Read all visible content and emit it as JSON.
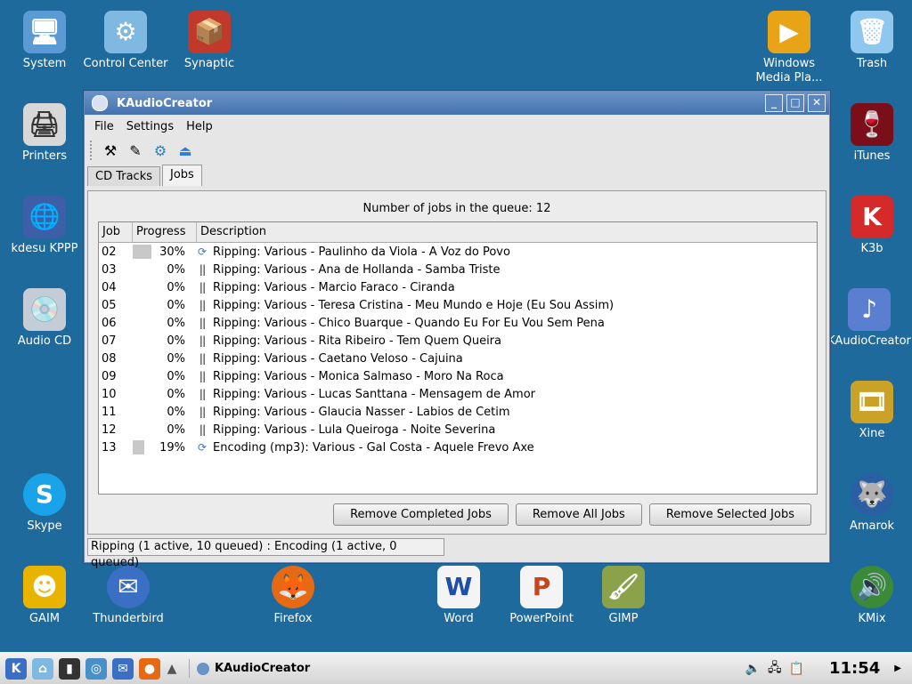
{
  "desktop_icons": [
    {
      "label": "System"
    },
    {
      "label": "Control Center"
    },
    {
      "label": "Synaptic"
    },
    {
      "label": "Windows Media Pla..."
    },
    {
      "label": "Trash"
    },
    {
      "label": "Printers"
    },
    {
      "label": "iTunes"
    },
    {
      "label": "kdesu KPPP"
    },
    {
      "label": "K3b"
    },
    {
      "label": "Audio CD"
    },
    {
      "label": "KAudioCreator"
    },
    {
      "label": "Xine"
    },
    {
      "label": "Skype"
    },
    {
      "label": "Amarok"
    },
    {
      "label": "GAIM"
    },
    {
      "label": "Thunderbird"
    },
    {
      "label": "Firefox"
    },
    {
      "label": "Word"
    },
    {
      "label": "PowerPoint"
    },
    {
      "label": "GIMP"
    },
    {
      "label": "KMix"
    }
  ],
  "window": {
    "title": "KAudioCreator",
    "menu": [
      "File",
      "Settings",
      "Help"
    ],
    "tabs": [
      "CD Tracks",
      "Jobs"
    ],
    "queue_info": "Number of jobs in the queue: 12",
    "columns": [
      "Job",
      "Progress",
      "Description"
    ],
    "jobs": [
      {
        "job": "02",
        "progress": "30%",
        "pct": 30,
        "state": "running",
        "description": "Ripping: Various - Paulinho da Viola - A Voz do Povo"
      },
      {
        "job": "03",
        "progress": "0%",
        "pct": 0,
        "state": "queued",
        "description": "Ripping: Various - Ana de Hollanda - Samba Triste"
      },
      {
        "job": "04",
        "progress": "0%",
        "pct": 0,
        "state": "queued",
        "description": "Ripping: Various - Marcio Faraco - Ciranda"
      },
      {
        "job": "05",
        "progress": "0%",
        "pct": 0,
        "state": "queued",
        "description": "Ripping: Various - Teresa Cristina - Meu Mundo e Hoje (Eu Sou Assim)"
      },
      {
        "job": "06",
        "progress": "0%",
        "pct": 0,
        "state": "queued",
        "description": "Ripping: Various - Chico Buarque - Quando Eu For Eu Vou Sem Pena"
      },
      {
        "job": "07",
        "progress": "0%",
        "pct": 0,
        "state": "queued",
        "description": "Ripping: Various - Rita Ribeiro - Tem Quem Queira"
      },
      {
        "job": "08",
        "progress": "0%",
        "pct": 0,
        "state": "queued",
        "description": "Ripping: Various - Caetano Veloso - Cajuina"
      },
      {
        "job": "09",
        "progress": "0%",
        "pct": 0,
        "state": "queued",
        "description": "Ripping: Various - Monica Salmaso - Moro Na Roca"
      },
      {
        "job": "10",
        "progress": "0%",
        "pct": 0,
        "state": "queued",
        "description": "Ripping: Various - Lucas Santtana - Mensagem de Amor"
      },
      {
        "job": "11",
        "progress": "0%",
        "pct": 0,
        "state": "queued",
        "description": "Ripping: Various - Glaucia Nasser - Labios de Cetim"
      },
      {
        "job": "12",
        "progress": "0%",
        "pct": 0,
        "state": "queued",
        "description": "Ripping: Various - Lula Queiroga - Noite Severina"
      },
      {
        "job": "13",
        "progress": "19%",
        "pct": 19,
        "state": "running",
        "description": "Encoding (mp3): Various - Gal Costa - Aquele Frevo Axe"
      }
    ],
    "buttons": {
      "remove_completed": "Remove Completed Jobs",
      "remove_all": "Remove All Jobs",
      "remove_selected": "Remove Selected Jobs"
    },
    "status": "Ripping (1 active, 10 queued) : Encoding (1 active, 0 queued)"
  },
  "taskbar": {
    "task_label": "KAudioCreator",
    "clock": "11:54"
  },
  "colors": {
    "desktop": "#1f6a9d",
    "accent": "#4572ad"
  }
}
